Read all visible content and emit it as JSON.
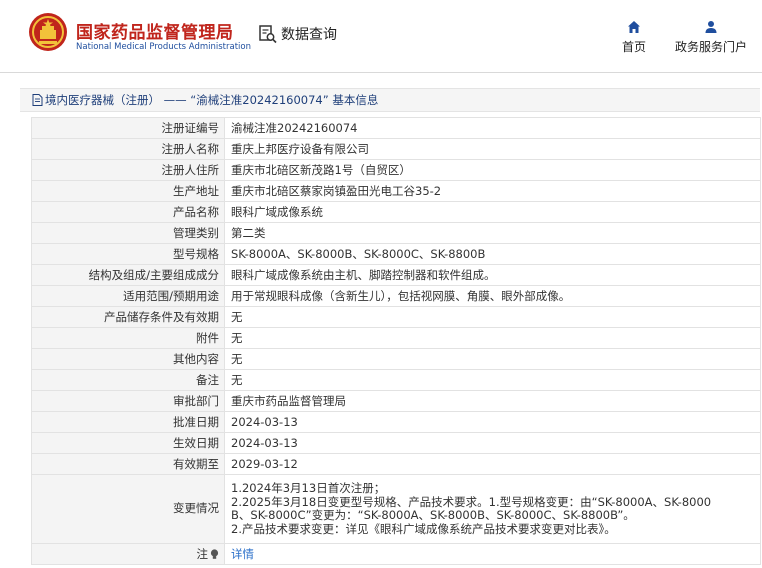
{
  "header": {
    "brand_cn": "国家药品监督管理局",
    "brand_en": "National Medical Products Administration",
    "search_label": "数据查询",
    "nav": {
      "home": "首页",
      "portal": "政务服务门户"
    },
    "accent_red": "#c0251c",
    "accent_blue": "#1f4e9e"
  },
  "breadcrumb": {
    "text": "境内医疗器械（注册） —— “渝械注准20242160074” 基本信息"
  },
  "rows": [
    {
      "label": "注册证编号",
      "value": "渝械注准20242160074"
    },
    {
      "label": "注册人名称",
      "value": "重庆上邦医疗设备有限公司"
    },
    {
      "label": "注册人住所",
      "value": "重庆市北碚区新茂路1号（自贸区）"
    },
    {
      "label": "生产地址",
      "value": "重庆市北碚区蔡家岗镇盈田光电工谷35-2"
    },
    {
      "label": "产品名称",
      "value": "眼科广域成像系统"
    },
    {
      "label": "管理类别",
      "value": "第二类"
    },
    {
      "label": "型号规格",
      "value": "SK-8000A、SK-8000B、SK-8000C、SK-8800B"
    },
    {
      "label": "结构及组成/主要组成成分",
      "value": "眼科广域成像系统由主机、脚踏控制器和软件组成。"
    },
    {
      "label": "适用范围/预期用途",
      "value": "用于常规眼科成像（含新生儿），包括视网膜、角膜、眼外部成像。"
    },
    {
      "label": "产品储存条件及有效期",
      "value": "无"
    },
    {
      "label": "附件",
      "value": "无"
    },
    {
      "label": "其他内容",
      "value": "无"
    },
    {
      "label": "备注",
      "value": "无"
    },
    {
      "label": "审批部门",
      "value": "重庆市药品监督管理局"
    },
    {
      "label": "批准日期",
      "value": "2024-03-13"
    },
    {
      "label": "生效日期",
      "value": "2024-03-13"
    },
    {
      "label": "有效期至",
      "value": "2029-03-12"
    }
  ],
  "change": {
    "label": "变更情况",
    "lines": [
      "1.2024年3月13日首次注册；",
      "2.2025年3月18日变更型号规格、产品技术要求。1.型号规格变更：由“SK-8000A、SK-8000",
      "B、SK-8000C”变更为：“SK-8000A、SK-8000B、SK-8000C、SK-8800B”。",
      "2.产品技术要求变更：详见《眼科广域成像系统产品技术要求变更对比表》。"
    ]
  },
  "note": {
    "label": "注",
    "link": "详情"
  }
}
